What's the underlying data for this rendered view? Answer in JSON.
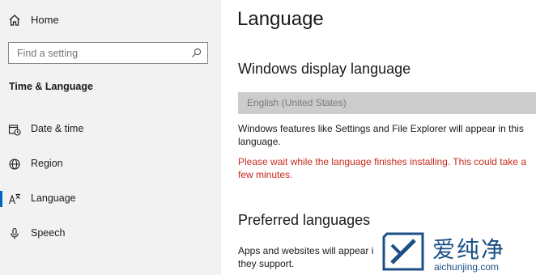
{
  "sidebar": {
    "home_label": "Home",
    "search_placeholder": "Find a setting",
    "section_title": "Time & Language",
    "items": [
      {
        "label": "Date & time",
        "icon": "calendar-clock-icon"
      },
      {
        "label": "Region",
        "icon": "globe-icon"
      },
      {
        "label": "Language",
        "icon": "language-icon"
      },
      {
        "label": "Speech",
        "icon": "microphone-icon"
      }
    ]
  },
  "main": {
    "title": "Language",
    "display_language": {
      "heading": "Windows display language",
      "selected": "English (United States)",
      "description": "Windows features like Settings and File Explorer will appear in this language.",
      "warning": "Please wait while the language finishes installing. This could take a few minutes."
    },
    "preferred": {
      "heading": "Preferred languages",
      "description": "Apps and websites will appear i they support."
    }
  },
  "watermark": {
    "brand": "爱纯净",
    "url": "aichunjing.com"
  },
  "colors": {
    "accent": "#0067c0",
    "warning": "#c42b1c",
    "sidebar_bg": "#f2f2f2",
    "disabled_select": "#cccccc"
  }
}
